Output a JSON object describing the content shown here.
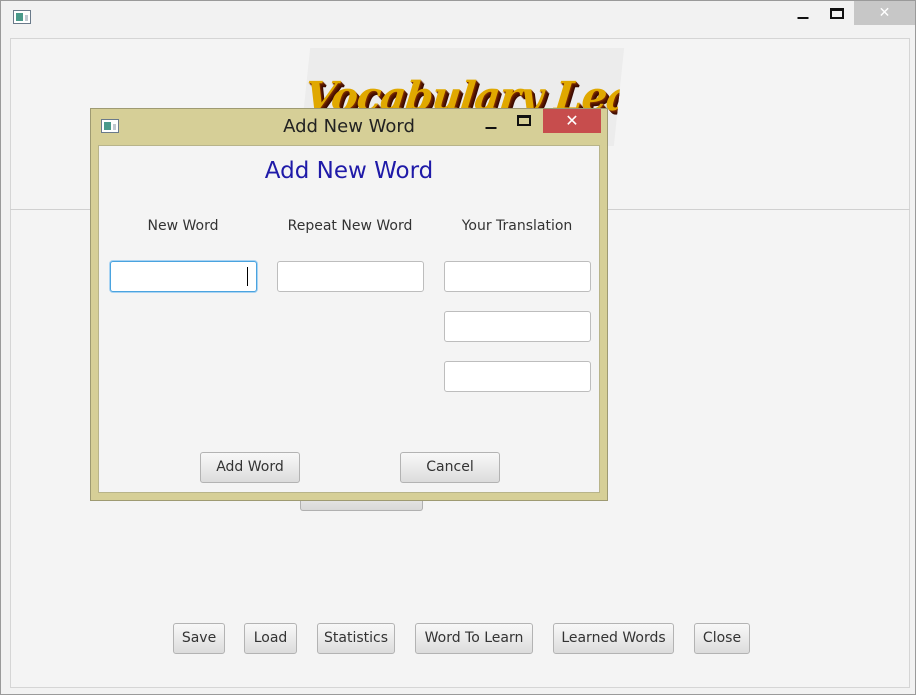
{
  "main_window": {
    "close_glyph": "✕",
    "buttons": [
      "Save",
      "Load",
      "Statistics",
      "Word To Learn",
      "Learned Words",
      "Close"
    ],
    "logo_text": "Vocabulary Learner"
  },
  "dialog": {
    "title": "Add New Word",
    "heading": "Add New Word",
    "close_glyph": "✕",
    "labels": {
      "new_word": "New Word",
      "repeat_new_word": "Repeat New Word",
      "your_translation": "Your Translation"
    },
    "fields": {
      "new_word": "",
      "repeat_new_word": "",
      "translation_1": "",
      "translation_2": "",
      "translation_3": ""
    },
    "add_button": "Add Word",
    "cancel_button": "Cancel"
  },
  "colors": {
    "dialog_frame": "#d6cf97",
    "heading": "#1f1aa8",
    "close_red": "#c74d4d"
  }
}
